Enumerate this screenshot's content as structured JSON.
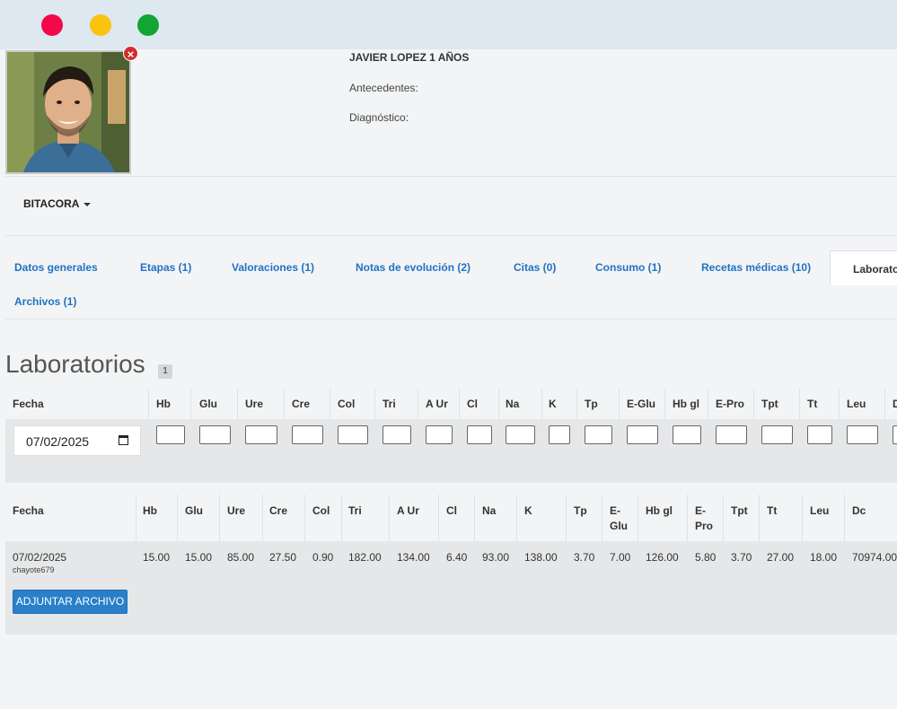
{
  "window": {
    "controls": [
      "close",
      "minimize",
      "maximize"
    ],
    "colors": {
      "close": "#f2094a",
      "minimize": "#fbc310",
      "maximize": "#12a434"
    }
  },
  "patient": {
    "name": "JAVIER LOPEZ 1 AÑOS",
    "antecedentes_label": "Antecedentes:",
    "diagnostico_label": "Diagnóstico:"
  },
  "bitacora": {
    "label": "BITACORA"
  },
  "tabs": [
    {
      "label": "Datos generales"
    },
    {
      "label": "Etapas (1)"
    },
    {
      "label": "Valoraciones (1)"
    },
    {
      "label": "Notas de evolución (2)"
    },
    {
      "label": "Citas (0)"
    },
    {
      "label": "Consumo (1)"
    },
    {
      "label": "Recetas médicas (10)"
    },
    {
      "label": "Laboratorios"
    },
    {
      "label": "Archivos (1)"
    }
  ],
  "section": {
    "title": "Laboratorios",
    "count": "1"
  },
  "form": {
    "headers": [
      "Fecha",
      "Hb",
      "Glu",
      "Ure",
      "Cre",
      "Col",
      "Tri",
      "A Ur",
      "Cl",
      "Na",
      "K",
      "Tp",
      "E-Glu",
      "Hb gl",
      "E-Pro",
      "Tpt",
      "Tt",
      "Leu",
      "D"
    ],
    "date_value": "07/02/2025"
  },
  "results": {
    "headers": [
      "Fecha",
      "Hb",
      "Glu",
      "Ure",
      "Cre",
      "Col",
      "Tri",
      "A Ur",
      "Cl",
      "Na",
      "K",
      "Tp",
      "E-\nGlu",
      "Hb gl",
      "E-\nPro",
      "Tpt",
      "Tt",
      "Leu",
      "Dc"
    ],
    "row": {
      "date": "07/02/2025",
      "user": "chayote679",
      "values": [
        "15.00",
        "15.00",
        "85.00",
        "27.50",
        "0.90",
        "182.00",
        "134.00",
        "6.40",
        "93.00",
        "138.00",
        "3.70",
        "7.00",
        "126.00",
        "5.80",
        "3.70",
        "27.00",
        "18.00",
        "70974.00"
      ]
    },
    "attach_button": "ADJUNTAR ARCHIVO"
  },
  "accent_color": "#1f72c4"
}
